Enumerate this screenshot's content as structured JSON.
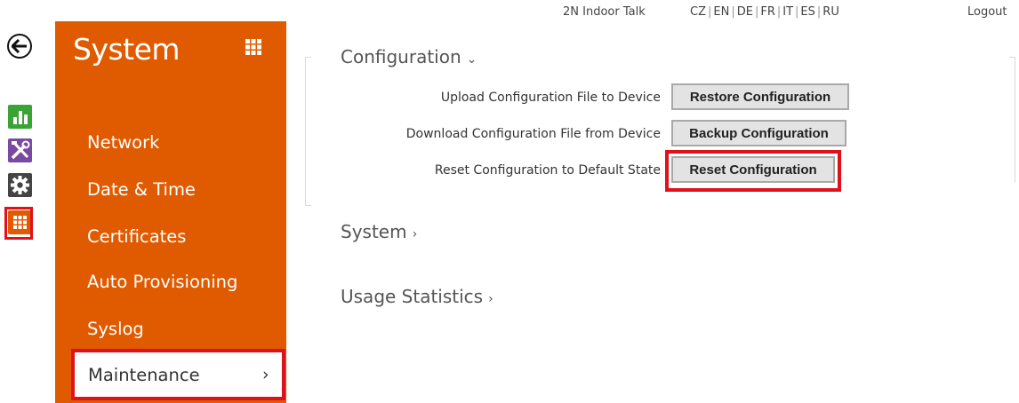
{
  "topbar": {
    "device": "2N Indoor Talk",
    "languages": [
      "CZ",
      "EN",
      "DE",
      "FR",
      "IT",
      "ES",
      "RU"
    ],
    "logout": "Logout"
  },
  "rail": {
    "icons": [
      "back-arrow-icon",
      "status-chart-icon",
      "services-tools-icon",
      "hardware-gear-icon",
      "system-grid-icon"
    ],
    "colors": {
      "status": "#3aa335",
      "services": "#7a4aa0",
      "hardware": "#444444",
      "system": "#e05a00"
    }
  },
  "sidebar": {
    "title": "System",
    "items": [
      {
        "label": "Network"
      },
      {
        "label": "Date & Time"
      },
      {
        "label": "Certificates"
      },
      {
        "label": "Auto Provisioning"
      },
      {
        "label": "Syslog"
      }
    ],
    "active_item": {
      "label": "Maintenance",
      "chevron": "›"
    },
    "accent_color": "#e05a00",
    "highlight_color": "#e0101c"
  },
  "main": {
    "configuration": {
      "title": "Configuration",
      "arrow": "⌄",
      "rows": [
        {
          "label": "Upload Configuration File to Device",
          "button": "Restore Configuration"
        },
        {
          "label": "Download Configuration File from Device",
          "button": "Backup Configuration"
        },
        {
          "label": "Reset Configuration to Default State",
          "button": "Reset Configuration"
        }
      ]
    },
    "system_section": {
      "title": "System",
      "arrow": "›"
    },
    "usage_section": {
      "title": "Usage Statistics",
      "arrow": "›"
    }
  }
}
